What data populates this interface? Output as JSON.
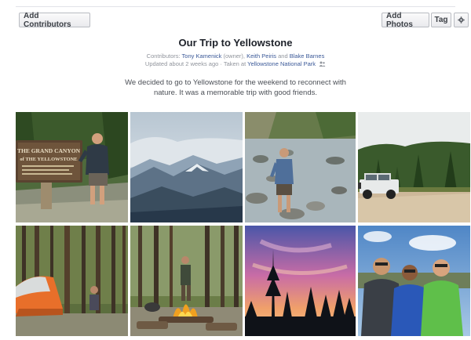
{
  "toolbar": {
    "add_contributors_label": "Add Contributors",
    "add_photos_label": "Add Photos",
    "tag_label": "Tag",
    "settings_icon": "gear-icon"
  },
  "album": {
    "title": "Our Trip to Yellowstone",
    "contributors_prefix": "Contributors: ",
    "contributor_1": "Tony Kamenick",
    "owner_note": " (owner), ",
    "contributor_2": "Keith Peiris",
    "and_text": " and ",
    "contributor_3": "Blake Barnes",
    "updated_text": "Updated about 2 weeks ago · Taken at ",
    "location": "Yellowstone National Park",
    "privacy_icon": "friends-icon",
    "description": "We decided to go to Yellowstone for the weekend to reconnect with nature. It was a memorable trip with good friends."
  },
  "photos": [
    {
      "subject": "Grand Canyon of the Yellowstone sign",
      "sign_line1": "THE GRAND CANYON",
      "sign_line2": "of THE YELLOWSTONE"
    },
    {
      "subject": "mountain valley vista"
    },
    {
      "subject": "person standing in rocky river"
    },
    {
      "subject": "jeep on dirt road by forest"
    },
    {
      "subject": "orange tent in pine forest"
    },
    {
      "subject": "campfire in forest"
    },
    {
      "subject": "sunset sky with pine silhouettes"
    },
    {
      "subject": "three friends selfie"
    }
  ],
  "colors": {
    "link": "#3b5998",
    "meta_gray": "#90949c",
    "button_border": "#b9bcc2"
  }
}
